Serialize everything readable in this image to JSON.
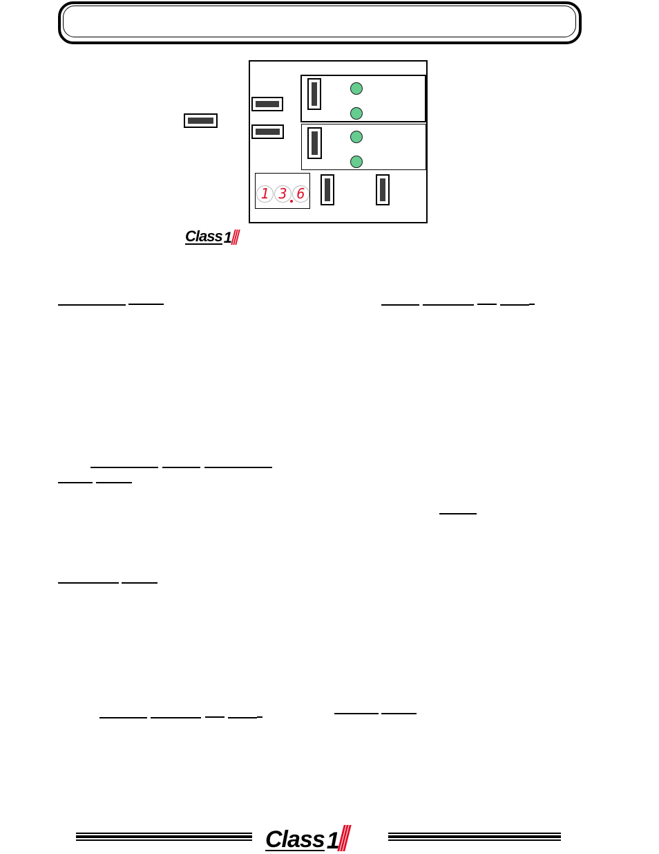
{
  "header": {
    "title": ""
  },
  "panel": {
    "display": {
      "digits": [
        "1",
        "3",
        "6"
      ],
      "decimal_after_index": 1,
      "value": "13.6",
      "digit_color": "#e0102a"
    },
    "led_color": "#66cc90",
    "switch_color": "#3d3d3d",
    "groups": [
      {
        "name": "upper-switch-group",
        "leds": 2
      },
      {
        "name": "lower-switch-group",
        "leds": 2
      }
    ]
  },
  "logo": {
    "word": "Class",
    "numeral": "1",
    "stripe_color": "#e0102a"
  },
  "footer": {
    "logo_word": "Class",
    "logo_numeral": "1"
  }
}
